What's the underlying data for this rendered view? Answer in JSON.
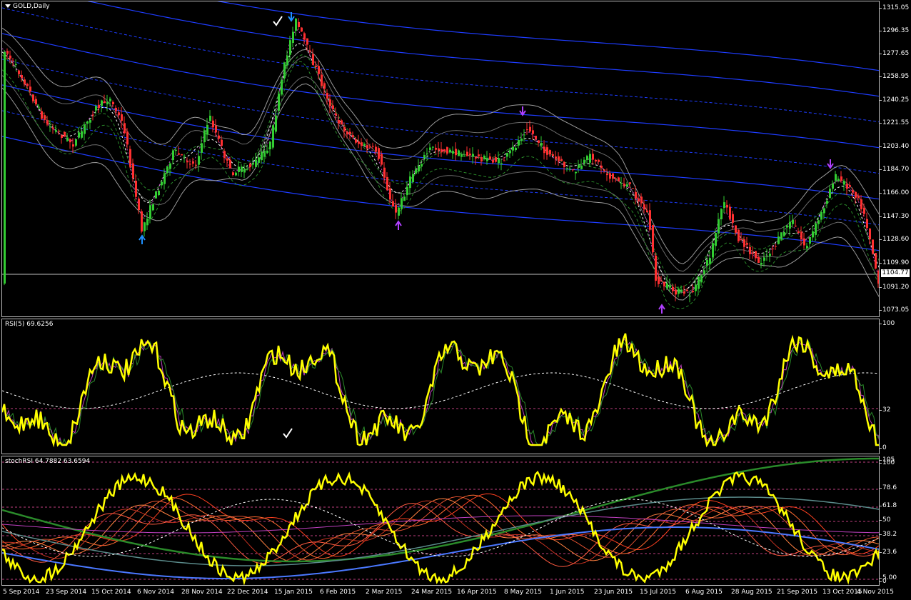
{
  "window": {
    "title": "GOLD,Daily"
  },
  "price_pane": {
    "axis_labels": [
      "1315.05",
      "1296.35",
      "1277.65",
      "1258.95",
      "1240.25",
      "1221.55",
      "1203.40",
      "1184.70",
      "1166.00",
      "1147.30",
      "1128.60",
      "1109.90",
      "1091.20",
      "1073.05"
    ],
    "current_price": "1104.77"
  },
  "rsi_pane": {
    "title": "RSI(5) 69.6256",
    "axis_labels": [
      "100",
      "32",
      "0"
    ]
  },
  "stoch_pane": {
    "title": "stochRSI 64.7882 63.6594",
    "axis_labels": [
      "105",
      "100",
      "78.6",
      "61.8",
      "50",
      "38.2",
      "23.6",
      "5.00",
      "0"
    ]
  },
  "time_axis": [
    "5 Sep 2014",
    "23 Sep 2014",
    "15 Oct 2014",
    "6 Nov 2014",
    "28 Nov 2014",
    "22 Dec 2014",
    "15 Jan 2015",
    "6 Feb 2015",
    "2 Mar 2015",
    "24 Mar 2015",
    "16 Apr 2015",
    "8 May 2015",
    "1 Jun 2015",
    "23 Jun 2015",
    "15 Jul 2015",
    "6 Aug 2015",
    "28 Aug 2015",
    "21 Sep 2015",
    "13 Oct 2015",
    "4 Nov 2015"
  ],
  "colors": {
    "background": "#000000",
    "bull_candle": "#32cd32",
    "bear_candle": "#ff3030",
    "rsi_line": "#ffff00",
    "band_blue": "#1e3cff",
    "band_gray": "#8c8c8c",
    "arrow_blue": "#1e90ff",
    "arrow_purple": "#b040ff",
    "level_line": "#c04080"
  },
  "icons": {
    "checkmark": "checkmark-icon",
    "arrow_down": "arrow-down-icon",
    "arrow_up": "arrow-up-icon"
  }
}
